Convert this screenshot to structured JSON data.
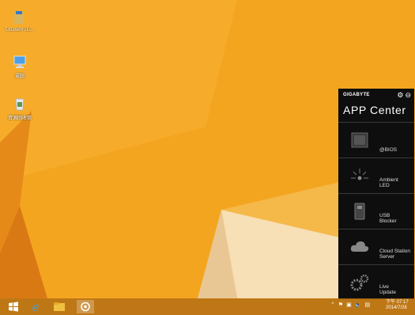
{
  "desktop": {
    "icons": [
      {
        "label": "GIGABYTE..."
      },
      {
        "label": "電腦"
      },
      {
        "label": "資源回收筒"
      }
    ]
  },
  "app_center": {
    "brand": "GIGABYTE",
    "title": "APP Center",
    "apps": [
      {
        "name": "@BIOS"
      },
      {
        "name": "Ambient\nLED"
      },
      {
        "name": "USB\nBlocker"
      },
      {
        "name": "Cloud Station\nServer"
      },
      {
        "name": "Live\nUpdate"
      }
    ]
  },
  "taskbar": {
    "clock_time": "下午 07:17",
    "clock_date": "2014/7/28"
  },
  "colors": {
    "wallpaper": "#f3a21c",
    "panel": "#0e0e0e"
  }
}
